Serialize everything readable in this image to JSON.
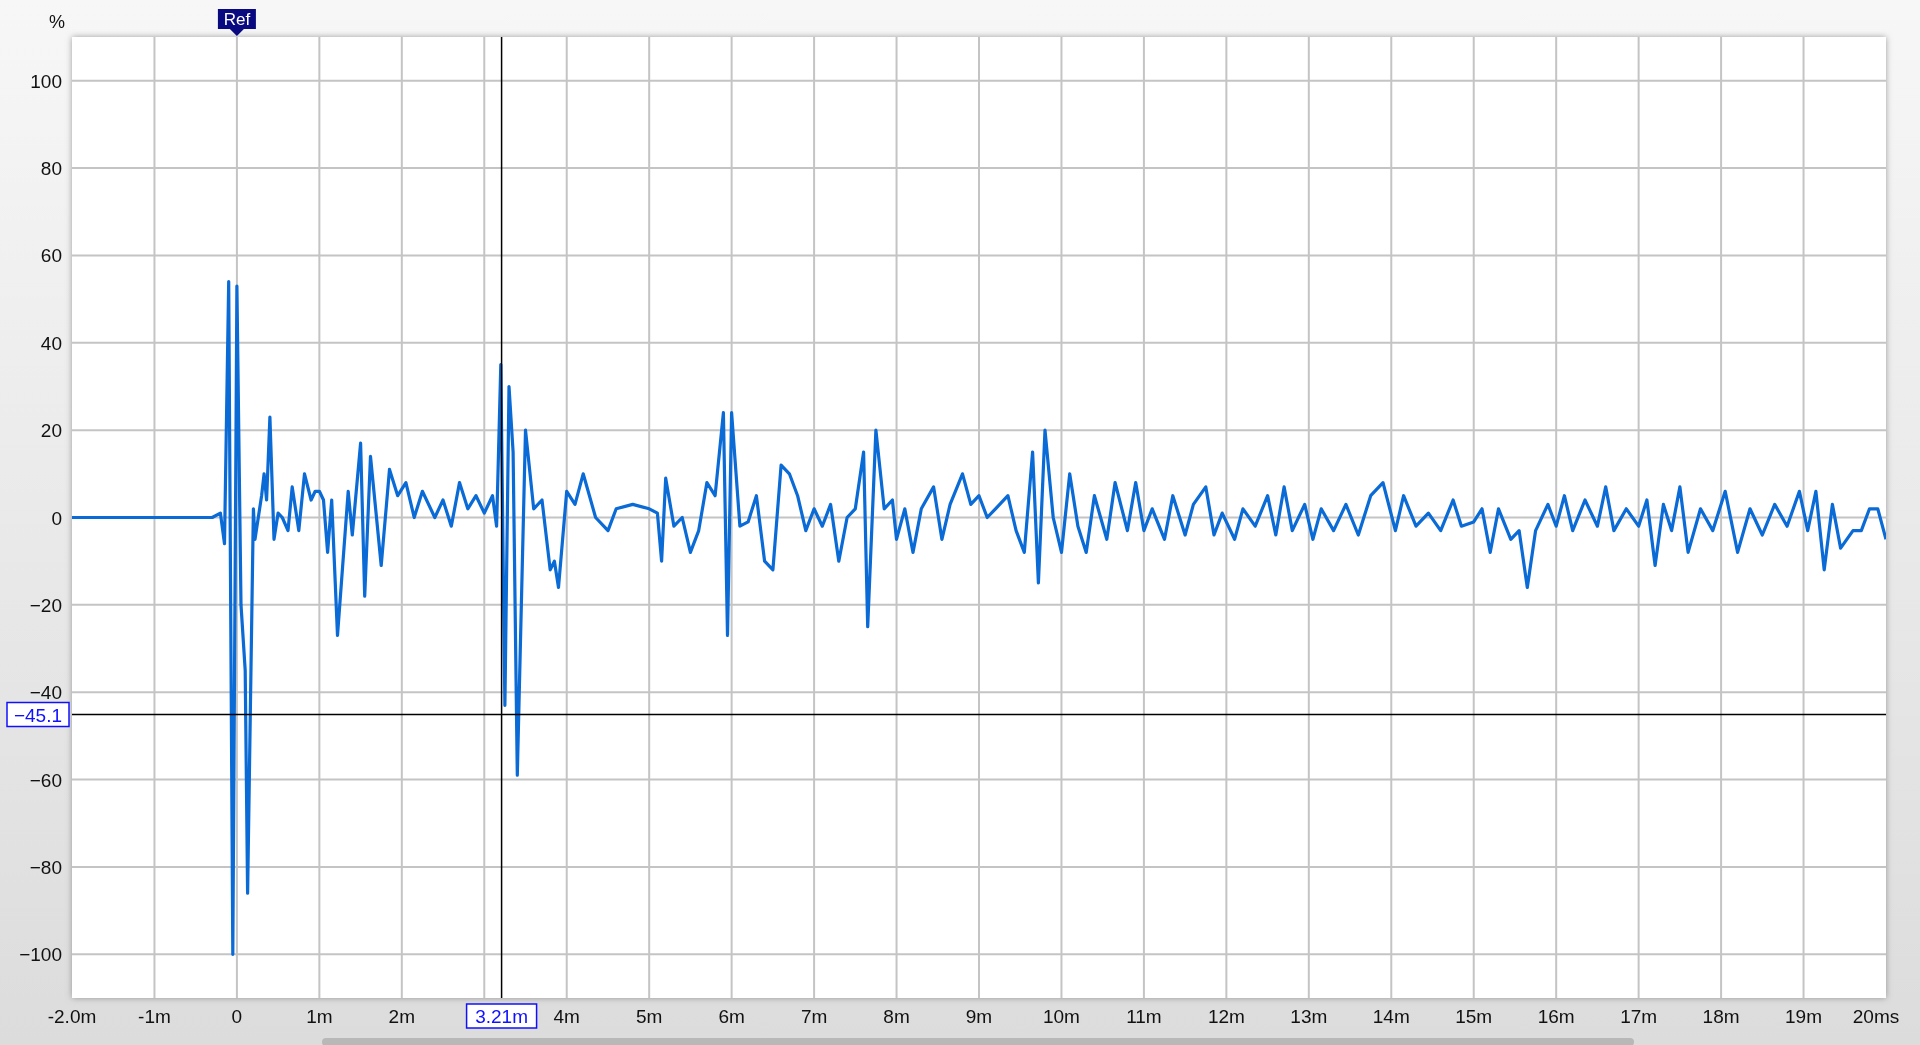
{
  "chart_data": {
    "type": "line",
    "ylabel": "%",
    "xlim": [
      -2,
      20
    ],
    "ylim": [
      -110,
      110
    ],
    "xticks": [
      {
        "value": -2,
        "label": "-2.0m"
      },
      {
        "value": -1,
        "label": "-1m"
      },
      {
        "value": 0,
        "label": "0"
      },
      {
        "value": 1,
        "label": "1m"
      },
      {
        "value": 2,
        "label": "2m"
      },
      {
        "value": 4,
        "label": "4m"
      },
      {
        "value": 5,
        "label": "5m"
      },
      {
        "value": 6,
        "label": "6m"
      },
      {
        "value": 7,
        "label": "7m"
      },
      {
        "value": 8,
        "label": "8m"
      },
      {
        "value": 9,
        "label": "9m"
      },
      {
        "value": 10,
        "label": "10m"
      },
      {
        "value": 11,
        "label": "11m"
      },
      {
        "value": 12,
        "label": "12m"
      },
      {
        "value": 13,
        "label": "13m"
      },
      {
        "value": 14,
        "label": "14m"
      },
      {
        "value": 15,
        "label": "15m"
      },
      {
        "value": 16,
        "label": "16m"
      },
      {
        "value": 17,
        "label": "17m"
      },
      {
        "value": 18,
        "label": "18m"
      },
      {
        "value": 19,
        "label": "19m"
      },
      {
        "value": 20,
        "label": "20ms"
      }
    ],
    "yticks": [
      {
        "value": -100,
        "label": "−100"
      },
      {
        "value": -80,
        "label": "−80"
      },
      {
        "value": -60,
        "label": "−60"
      },
      {
        "value": -40,
        "label": "−40"
      },
      {
        "value": -20,
        "label": "−20"
      },
      {
        "value": 0,
        "label": "0"
      },
      {
        "value": 20,
        "label": "20"
      },
      {
        "value": 40,
        "label": "40"
      },
      {
        "value": 60,
        "label": "60"
      },
      {
        "value": 80,
        "label": "80"
      },
      {
        "value": 100,
        "label": "100"
      }
    ],
    "x": [
      -2,
      -0.3,
      -0.2,
      -0.15,
      -0.1,
      -0.05,
      0,
      0.05,
      0.1,
      0.13,
      0.2,
      0.22,
      0.3,
      0.33,
      0.36,
      0.4,
      0.45,
      0.5,
      0.55,
      0.62,
      0.67,
      0.75,
      0.82,
      0.9,
      0.95,
      1,
      1.05,
      1.1,
      1.15,
      1.22,
      1.35,
      1.4,
      1.5,
      1.55,
      1.62,
      1.75,
      1.85,
      1.95,
      2.05,
      2.15,
      2.25,
      2.4,
      2.5,
      2.6,
      2.7,
      2.8,
      2.9,
      3,
      3.1,
      3.15,
      3.2,
      3.25,
      3.3,
      3.35,
      3.4,
      3.5,
      3.6,
      3.7,
      3.8,
      3.85,
      3.9,
      4,
      4.1,
      4.2,
      4.35,
      4.5,
      4.6,
      4.8,
      5,
      5.1,
      5.15,
      5.2,
      5.3,
      5.4,
      5.5,
      5.6,
      5.7,
      5.8,
      5.9,
      5.95,
      6,
      6.1,
      6.2,
      6.3,
      6.4,
      6.5,
      6.6,
      6.7,
      6.8,
      6.9,
      7,
      7.1,
      7.2,
      7.3,
      7.4,
      7.5,
      7.6,
      7.65,
      7.75,
      7.85,
      7.95,
      8,
      8.1,
      8.2,
      8.3,
      8.45,
      8.55,
      8.65,
      8.8,
      8.9,
      9,
      9.1,
      9.2,
      9.35,
      9.45,
      9.55,
      9.65,
      9.72,
      9.8,
      9.9,
      10,
      10.1,
      10.2,
      10.3,
      10.4,
      10.55,
      10.65,
      10.8,
      10.9,
      11,
      11.1,
      11.25,
      11.35,
      11.5,
      11.6,
      11.75,
      11.85,
      11.95,
      12.1,
      12.2,
      12.35,
      12.5,
      12.6,
      12.7,
      12.8,
      12.95,
      13.05,
      13.15,
      13.3,
      13.45,
      13.6,
      13.75,
      13.9,
      14.05,
      14.15,
      14.3,
      14.45,
      14.6,
      14.75,
      14.85,
      15,
      15.1,
      15.2,
      15.3,
      15.45,
      15.55,
      15.65,
      15.75,
      15.9,
      16,
      16.1,
      16.2,
      16.35,
      16.5,
      16.6,
      16.7,
      16.85,
      17,
      17.1,
      17.2,
      17.3,
      17.4,
      17.5,
      17.6,
      17.75,
      17.9,
      18.05,
      18.2,
      18.35,
      18.5,
      18.65,
      18.8,
      18.95,
      19.05,
      19.15,
      19.25,
      19.35,
      19.45,
      19.6,
      19.7,
      19.8,
      19.9,
      20
    ],
    "series": [
      {
        "color": "#0a6ad6",
        "values": [
          0,
          0,
          1,
          -6,
          54,
          -100,
          53,
          -20,
          -35,
          -86,
          2,
          -5,
          5,
          10,
          4,
          23,
          -5,
          1,
          0,
          -3,
          7,
          -3,
          10,
          4,
          6,
          6,
          4,
          -8,
          4,
          -27,
          6,
          -4,
          17,
          -18,
          14,
          -11,
          11,
          5,
          8,
          0,
          6,
          0,
          4,
          -2,
          8,
          2,
          5,
          1,
          5,
          -2,
          35,
          -43,
          30,
          15,
          -59,
          20,
          2,
          4,
          -12,
          -10,
          -16,
          6,
          3,
          10,
          0,
          -3,
          2,
          3,
          2,
          1,
          -10,
          9,
          -2,
          0,
          -8,
          -3,
          8,
          5,
          24,
          -27,
          24,
          -2,
          -1,
          5,
          -10,
          -12,
          12,
          10,
          5,
          -3,
          2,
          -2,
          3,
          -10,
          0,
          2,
          15,
          -25,
          20,
          2,
          4,
          -5,
          2,
          -8,
          2,
          7,
          -5,
          3,
          10,
          3,
          5,
          0,
          2,
          5,
          -3,
          -8,
          15,
          -15,
          20,
          0,
          -8,
          10,
          -2,
          -8,
          5,
          -5,
          8,
          -3,
          8,
          -3,
          2,
          -5,
          5,
          -4,
          3,
          7,
          -4,
          1,
          -5,
          2,
          -2,
          5,
          -4,
          7,
          -3,
          3,
          -5,
          2,
          -3,
          3,
          -4,
          5,
          8,
          -3,
          5,
          -2,
          1,
          -3,
          4,
          -2,
          -1,
          2,
          -8,
          2,
          -5,
          -3,
          -16,
          -3,
          3,
          -2,
          5,
          -3,
          4,
          -2,
          7,
          -3,
          2,
          -2,
          4,
          -11,
          3,
          -3,
          7,
          -8,
          2,
          -3,
          6,
          -8,
          2,
          -4,
          3,
          -2,
          6,
          -3,
          6,
          -12,
          3,
          -7,
          -3,
          -3,
          2,
          2,
          -5
        ]
      }
    ],
    "grid": true,
    "annotations": [
      "Ref"
    ],
    "ref_lines": [
      {
        "axis": "x",
        "value": 3.21,
        "label": "3.21m",
        "color": "#000000"
      },
      {
        "axis": "y",
        "value": -45.1,
        "label": "−45.1",
        "color": "#000000"
      }
    ]
  }
}
